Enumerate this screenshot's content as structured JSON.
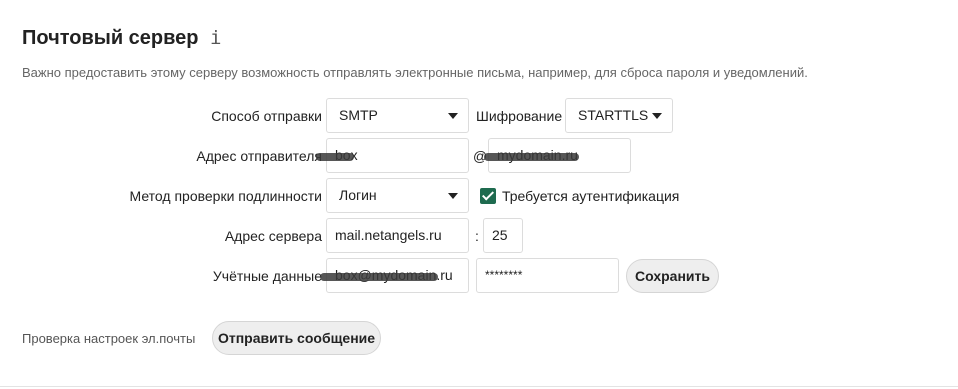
{
  "section": {
    "title": "Почтовый сервер",
    "info_icon": "info-icon",
    "description": "Важно предоставить этому серверу возможность отправлять электронные письма, например, для сброса пароля и уведомлений."
  },
  "form": {
    "send_mode": {
      "label": "Способ отправки",
      "value": "SMTP"
    },
    "encryption": {
      "label": "Шифрование",
      "value": "STARTTLS"
    },
    "from_address": {
      "label": "Адрес отправителя",
      "local_value": "box",
      "at": "@",
      "domain_value": "mydomain.ru"
    },
    "auth_method": {
      "label": "Метод проверки подлинности",
      "value": "Логин"
    },
    "auth_required": {
      "label": "Требуется аутентификация",
      "checked": true
    },
    "server": {
      "label": "Адрес сервера",
      "host": "mail.netangels.ru",
      "colon": ":",
      "port": "25"
    },
    "credentials": {
      "label": "Учётные данные",
      "user": "box@mydomain.ru",
      "password": "********"
    },
    "save_label": "Сохранить"
  },
  "test": {
    "label": "Проверка настроек эл.почты",
    "button_label": "Отправить сообщение"
  },
  "colors": {
    "checkbox": "#1e6b4f",
    "button_bg": "#eeeeee"
  }
}
